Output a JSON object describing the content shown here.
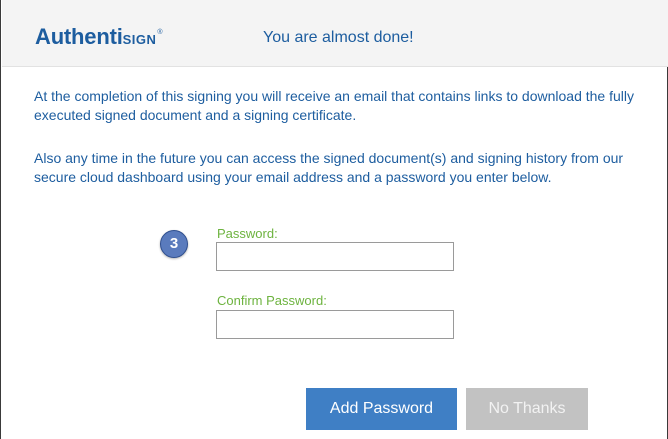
{
  "logo": {
    "part_main": "Authenti",
    "part_small": "SIGN",
    "mark": "®"
  },
  "header": {
    "title": "You are almost done!"
  },
  "body": {
    "paragraph1": "At the completion of this signing you will receive an email that contains links to download the fully executed signed document and a signing certificate.",
    "paragraph2": "Also any time in the future you can access the signed document(s) and signing history from our secure cloud dashboard using your email address and a password you enter below."
  },
  "form": {
    "step_number": "3",
    "password_label": "Password:",
    "password_value": "",
    "confirm_label": "Confirm Password:",
    "confirm_value": ""
  },
  "buttons": {
    "add_password": "Add Password",
    "no_thanks": "No Thanks"
  },
  "colors": {
    "brand_blue": "#1d5d9f",
    "label_green": "#6db33f",
    "primary_button": "#3f7fc5",
    "disabled_button": "#c2c2c2"
  }
}
